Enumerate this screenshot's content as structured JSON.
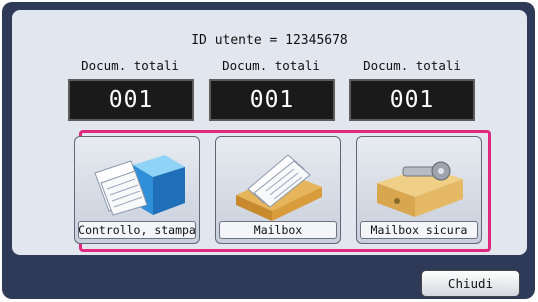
{
  "header": {
    "user_id_text": "ID utente = 12345678"
  },
  "counters": [
    {
      "label": "Docum. totali",
      "value": "001"
    },
    {
      "label": "Docum. totali",
      "value": "001"
    },
    {
      "label": "Docum. totali",
      "value": "001"
    }
  ],
  "modes": [
    {
      "label": "Controllo, stampa",
      "icon": "check-print-icon"
    },
    {
      "label": "Mailbox",
      "icon": "mailbox-tray-icon"
    },
    {
      "label": "Mailbox sicura",
      "icon": "secure-mailbox-icon"
    }
  ],
  "footer": {
    "close_label": "Chiudi"
  },
  "colors": {
    "frame": "#2e3a58",
    "panel": "#e2e6ee",
    "highlight": "#e0287f",
    "counter_bg": "#1a1a1a"
  }
}
